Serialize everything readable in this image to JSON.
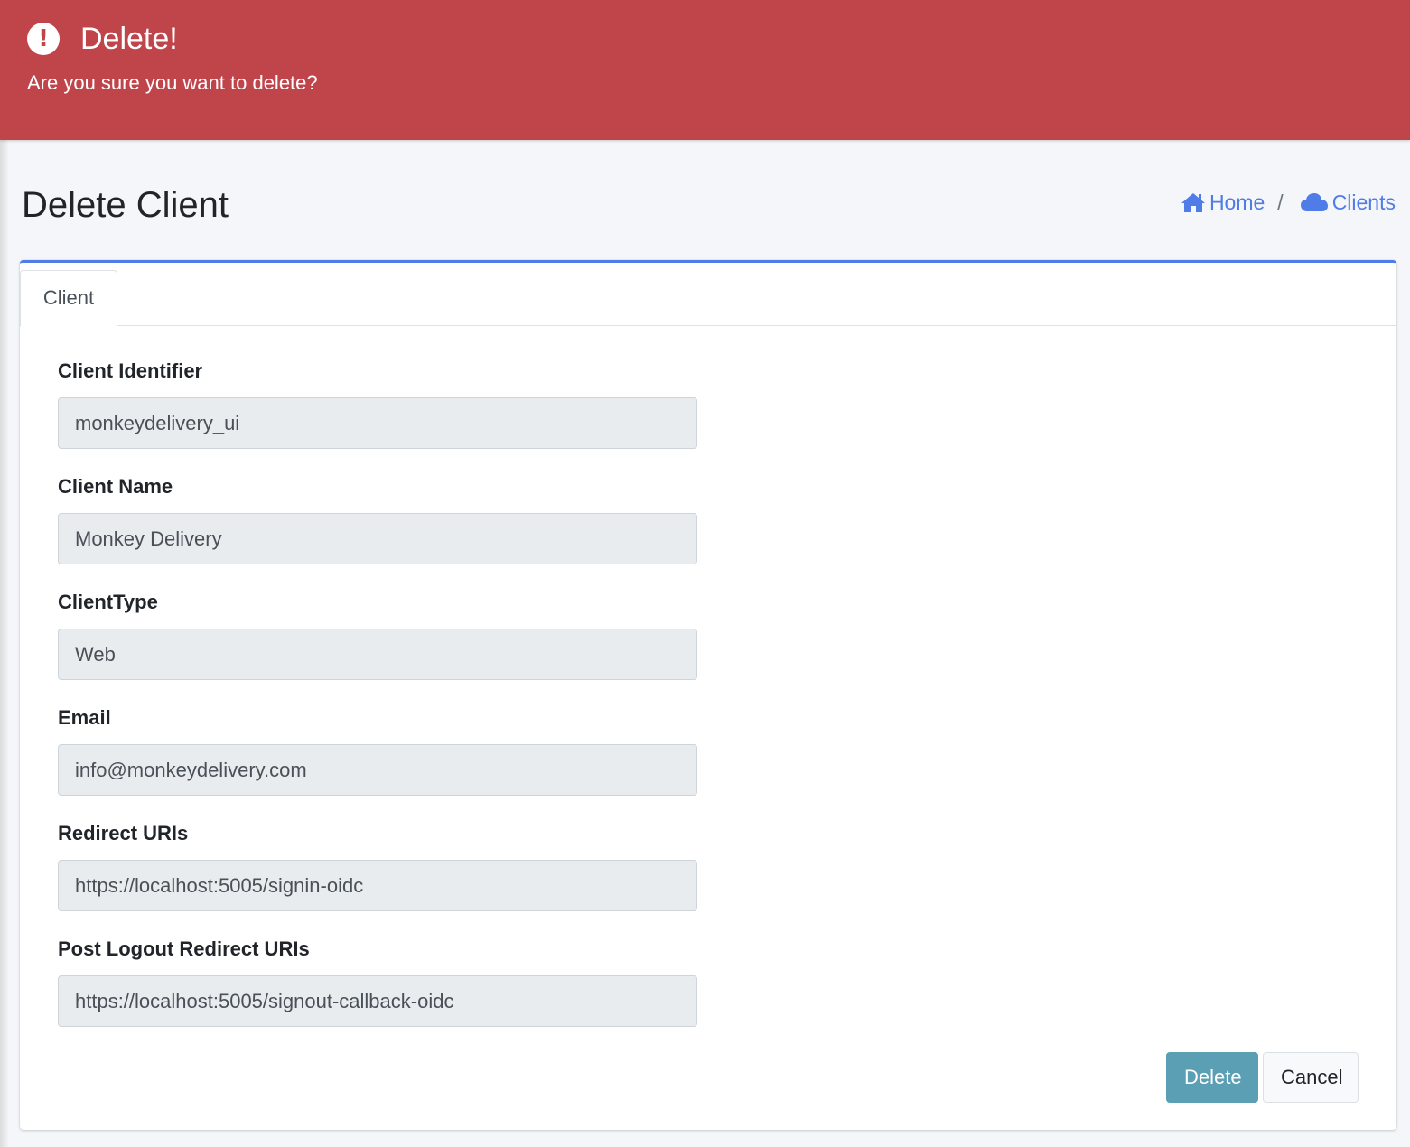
{
  "alert": {
    "icon": "exclamation-circle-icon",
    "title": "Delete!",
    "message": "Are you sure you want to delete?",
    "color": "#c0454b"
  },
  "page": {
    "title": "Delete Client"
  },
  "breadcrumb": {
    "home": "Home",
    "separator": "/",
    "clients": "Clients",
    "color": "#4f7ce6"
  },
  "tabs": [
    {
      "label": "Client"
    }
  ],
  "form": {
    "fields": [
      {
        "label": "Client Identifier",
        "value": "monkeydelivery_ui"
      },
      {
        "label": "Client Name",
        "value": "Monkey Delivery"
      },
      {
        "label": "ClientType",
        "value": "Web"
      },
      {
        "label": "Email",
        "value": "info@monkeydelivery.com"
      },
      {
        "label": "Redirect URIs",
        "value": "https://localhost:5005/signin-oidc"
      },
      {
        "label": "Post Logout Redirect URIs",
        "value": "https://localhost:5005/signout-callback-oidc"
      }
    ]
  },
  "actions": {
    "delete_label": "Delete",
    "cancel_label": "Cancel",
    "delete_color": "#5a9fb4"
  }
}
